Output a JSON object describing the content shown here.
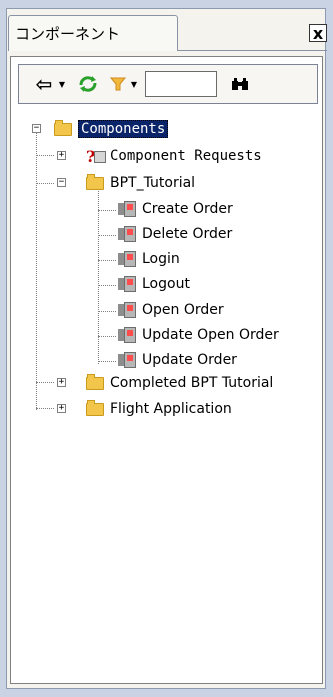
{
  "panel": {
    "tab_title": "コンポーネント",
    "close_label": "x"
  },
  "toolbar": {
    "back_icon": "back-arrow-icon",
    "refresh_icon": "refresh-icon",
    "filter_icon": "filter-icon",
    "search_value": "",
    "find_icon": "binoculars-icon"
  },
  "tree": {
    "root": "Components",
    "items": [
      {
        "label": "Component Requests",
        "type": "request",
        "expandable": true
      },
      {
        "label": "BPT_Tutorial",
        "type": "folder",
        "expandable": true,
        "expanded": true
      },
      {
        "label": "Create Order",
        "type": "component"
      },
      {
        "label": "Delete Order",
        "type": "component"
      },
      {
        "label": "Login",
        "type": "component"
      },
      {
        "label": "Logout",
        "type": "component"
      },
      {
        "label": "Open Order",
        "type": "component"
      },
      {
        "label": "Update Open Order",
        "type": "component"
      },
      {
        "label": "Update Order",
        "type": "component"
      },
      {
        "label": "Completed BPT Tutorial",
        "type": "folder",
        "expandable": true
      },
      {
        "label": "Flight Application",
        "type": "folder",
        "expandable": true
      }
    ]
  }
}
